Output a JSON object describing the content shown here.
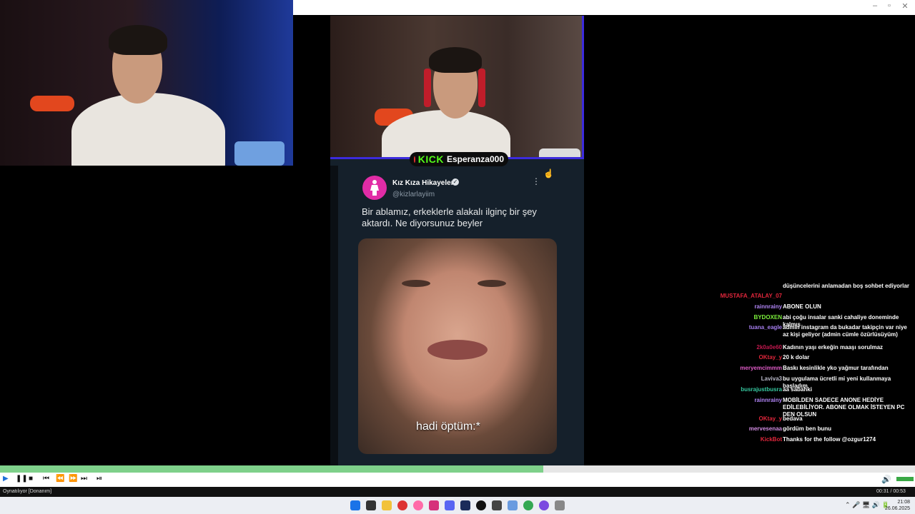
{
  "stream": {
    "kick_logo": "KICK",
    "channel_name": "Esperanza000"
  },
  "tweet": {
    "display_name": "Kız Kıza Hikayeler",
    "handle": "@kizlarlayiim",
    "text": "Bir ablamız, erkeklerle alakalı ilginç bir şey aktardı. Ne diyorsunuz beyler",
    "media_caption": "hadi öptüm:*"
  },
  "chat": {
    "messages": [
      {
        "user": "",
        "text": "düşüncelerini anlamadan boş sohbet ediyorlar",
        "color": "#ffffff"
      },
      {
        "user": "MUSTAFA_ATALAY_07",
        "text": "",
        "color": "#e0263b"
      },
      {
        "user": "rainnrainy",
        "text": "ABONE OLUN",
        "color": "#b084f5"
      },
      {
        "user": "BYDOXEN",
        "text": "abi çoğu insalar sanki cahaliye doneminde kalmış",
        "color": "#7cf03c"
      },
      {
        "user": "tuana_eagle",
        "text": "admin instagram da bukadar takipçin var niye az kişi geliyor (admin cümle özürlüsüyüm)",
        "color": "#a77ff0"
      },
      {
        "user": "2k0a0e60",
        "text": "Kadının yaşı erkeğin maaşı sorulmaz",
        "color": "#c2184e"
      },
      {
        "user": "OKtay_y",
        "text": "20 k dolar",
        "color": "#e0263b"
      },
      {
        "user": "meryemcimmm",
        "text": "Baskı kesinlikle yko yağmur tarafından",
        "color": "#e05cc8"
      },
      {
        "user": "Laviva3",
        "text": "bu uygulama ücretli mi yeni kullanmaya başladım",
        "color": "#b8b8c8"
      },
      {
        "user": "busrajustbusra",
        "text": "aa sabahki",
        "color": "#37c8a0"
      },
      {
        "user": "rainnrainy",
        "text": "MOBİLDEN SADECE ANONE HEDİYE EDİLEBİLİYOR. ABONE OLMAK İSTEYEN PC DEN OLSUN",
        "color": "#b084f5"
      },
      {
        "user": "OKtay_y",
        "text": "bedava",
        "color": "#e0263b"
      },
      {
        "user": "mervesenaa",
        "text": "gördüm ben bunu",
        "color": "#d08ce0"
      },
      {
        "user": "KickBot",
        "text": "Thanks for the follow @ozgur1274",
        "color": "#e0263b"
      }
    ]
  },
  "player": {
    "progress": 0.594,
    "status_text": "Oynatılıyor [Donanım]",
    "time_text": "00:31 / 00:53",
    "controls": [
      "play",
      "pause",
      "stop",
      "prev",
      "rewind",
      "forward",
      "next",
      "frame-step"
    ]
  },
  "taskbar": {
    "time": "21:08",
    "date": "26.06.2025"
  },
  "colors": {
    "kick_green": "#53fc18",
    "seek_fill": "#7ed08a",
    "stream_frame": "#3c2bdc"
  }
}
